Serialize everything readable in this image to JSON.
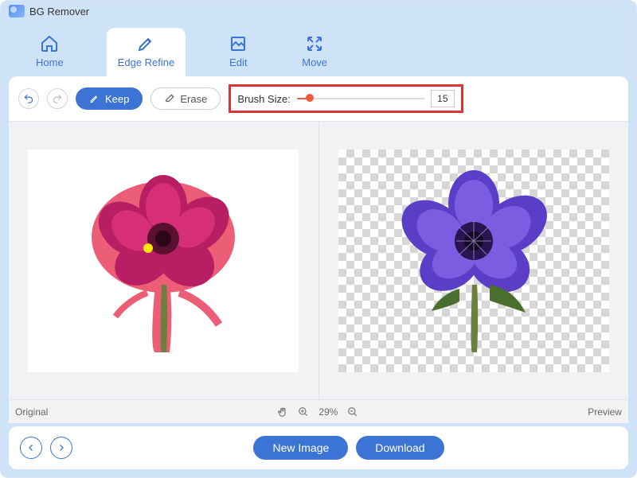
{
  "app": {
    "title": "BG Remover"
  },
  "tabs": {
    "home": "Home",
    "edge_refine": "Edge Refine",
    "edit": "Edit",
    "move": "Move",
    "active": "edge_refine"
  },
  "toolbar": {
    "keep_label": "Keep",
    "erase_label": "Erase",
    "brush_label": "Brush Size:",
    "brush_value": "15"
  },
  "status": {
    "left_label": "Original",
    "zoom_label": "29%",
    "right_label": "Preview"
  },
  "footer": {
    "new_image_label": "New Image",
    "download_label": "Download"
  },
  "colors": {
    "accent": "#3c74d6",
    "highlight_box": "#d83636",
    "slider": "#f05a3a"
  }
}
